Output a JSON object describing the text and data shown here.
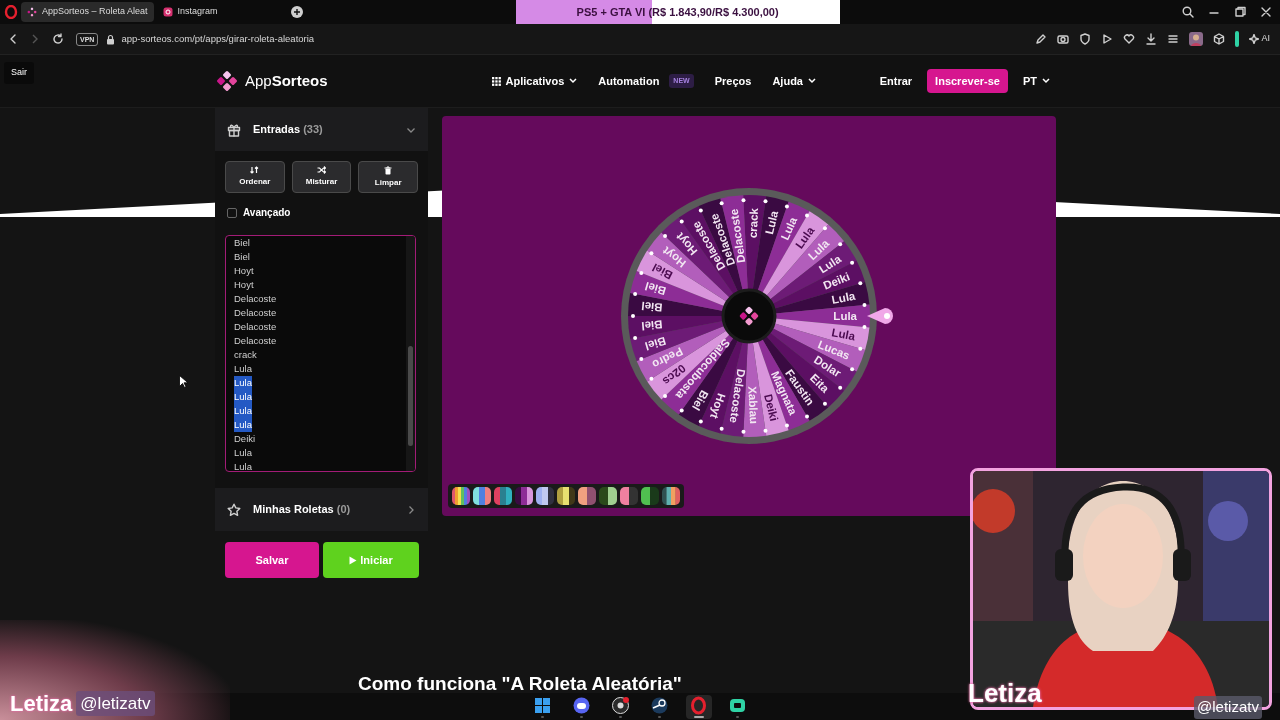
{
  "browser": {
    "tabs": [
      {
        "title": "AppSorteos – Roleta Aleat",
        "selected": true
      },
      {
        "title": "Instagram",
        "selected": false
      }
    ],
    "vpn": "VPN",
    "url": "app-sorteos.com/pt/apps/girar-roleta-aleatoria",
    "ai": "AI"
  },
  "stream_goal": {
    "label": "PS5 + GTA VI (R$ 1.843,90/R$ 4.300,00)",
    "level": 0.42
  },
  "tooltip": "Sair",
  "header": {
    "logo_left": "App",
    "logo_right": "Sorteos",
    "nav": [
      {
        "label": "Aplicativos",
        "kind": "apps"
      },
      {
        "label": "Automation",
        "kind": "badge",
        "badge": "NEW"
      },
      {
        "label": "Preços",
        "kind": "link"
      },
      {
        "label": "Ajuda",
        "kind": "dropdown"
      }
    ],
    "login": "Entrar",
    "signup": "Inscrever-se",
    "language": "PT"
  },
  "entries_panel": {
    "title": "Entradas",
    "count": "(33)",
    "expanded": true,
    "actions": [
      {
        "label": "Ordenar",
        "kind": "sort"
      },
      {
        "label": "Misturar",
        "kind": "shuffle"
      },
      {
        "label": "Limpar",
        "kind": "trash"
      }
    ],
    "advanced": {
      "label": "Avançado",
      "checked": false
    },
    "lines": [
      {
        "text": "Biel",
        "selected": false
      },
      {
        "text": "Biel",
        "selected": false
      },
      {
        "text": "Hoyt",
        "selected": false
      },
      {
        "text": "Hoyt",
        "selected": false
      },
      {
        "text": "Delacoste",
        "selected": false
      },
      {
        "text": "Delacoste",
        "selected": false
      },
      {
        "text": "Delacoste",
        "selected": false
      },
      {
        "text": "Delacoste",
        "selected": false
      },
      {
        "text": "crack",
        "selected": false
      },
      {
        "text": "Lula",
        "selected": false
      },
      {
        "text": "Lula",
        "selected": true
      },
      {
        "text": "Lula",
        "selected": true
      },
      {
        "text": "Lula",
        "selected": true
      },
      {
        "text": "Lula",
        "selected": true
      },
      {
        "text": "Deiki",
        "selected": false
      },
      {
        "text": "Lula",
        "selected": false
      },
      {
        "text": "Lula",
        "selected": false
      }
    ]
  },
  "saved_panel": {
    "title": "Minhas Roletas",
    "count": "(0)",
    "expanded": false
  },
  "buttons": {
    "save": "Salvar",
    "start": "Iniciar"
  },
  "wheel": {
    "segments": [
      {
        "label": "crack"
      },
      {
        "label": "Lula"
      },
      {
        "label": "Lula"
      },
      {
        "label": "Lula"
      },
      {
        "label": "Lula"
      },
      {
        "label": "Lula"
      },
      {
        "label": "Deiki"
      },
      {
        "label": "Lula"
      },
      {
        "label": "Lula"
      },
      {
        "label": "Lula"
      },
      {
        "label": "Lucas"
      },
      {
        "label": "Dolar"
      },
      {
        "label": "Eita"
      },
      {
        "label": "Faustin"
      },
      {
        "label": "Magnata"
      },
      {
        "label": "Deiki"
      },
      {
        "label": "Xablau"
      },
      {
        "label": "Delacoste"
      },
      {
        "label": "Hoyt"
      },
      {
        "label": "Biel"
      },
      {
        "label": "Saldocubosta"
      },
      {
        "label": "02cs"
      },
      {
        "label": "Pedro"
      },
      {
        "label": "Biel"
      },
      {
        "label": "Biel"
      },
      {
        "label": "Biel"
      },
      {
        "label": "Biel"
      },
      {
        "label": "Biel"
      },
      {
        "label": "Hoyt"
      },
      {
        "label": "Hoyt"
      },
      {
        "label": "Delacoste"
      },
      {
        "label": "Delacoste"
      },
      {
        "label": "Delacoste"
      }
    ]
  },
  "section_heading": "Como funciona \"A Roleta Aleatória\"",
  "overlay": {
    "name_left": "Letiza",
    "handle_left": "@letizatv",
    "name_right": "Letiza",
    "handle_right": "@letizatv"
  },
  "taskbar": [
    {
      "kind": "windows",
      "active": false
    },
    {
      "kind": "discord",
      "active": false
    },
    {
      "kind": "obs",
      "active": false
    },
    {
      "kind": "steam",
      "active": false
    },
    {
      "kind": "opera",
      "active": true
    },
    {
      "kind": "app",
      "active": false
    }
  ]
}
